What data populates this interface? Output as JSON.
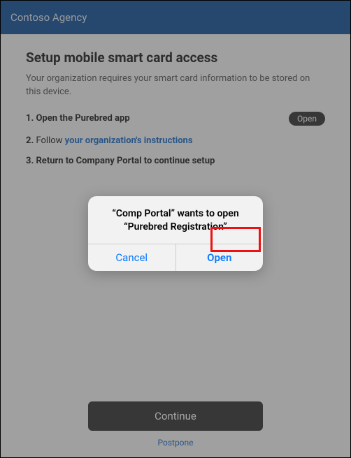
{
  "header": {
    "title": "Contoso Agency"
  },
  "main": {
    "title": "Setup mobile smart card access",
    "subtitle": "Your organization requires your smart card information to be stored on this device.",
    "steps": {
      "s1": {
        "ord": "1.",
        "text": "Open the Purebred app",
        "button": "Open"
      },
      "s2": {
        "ord": "2.",
        "prefix": "Follow ",
        "link": "your organization's instructions"
      },
      "s3": {
        "ord": "3.",
        "text": "Return to Company Portal to continue setup"
      }
    }
  },
  "footer": {
    "continue": "Continue",
    "postpone": "Postpone"
  },
  "alert": {
    "message": "“Comp Portal” wants to open “Purebred Registration”",
    "cancel": "Cancel",
    "open": "Open"
  }
}
